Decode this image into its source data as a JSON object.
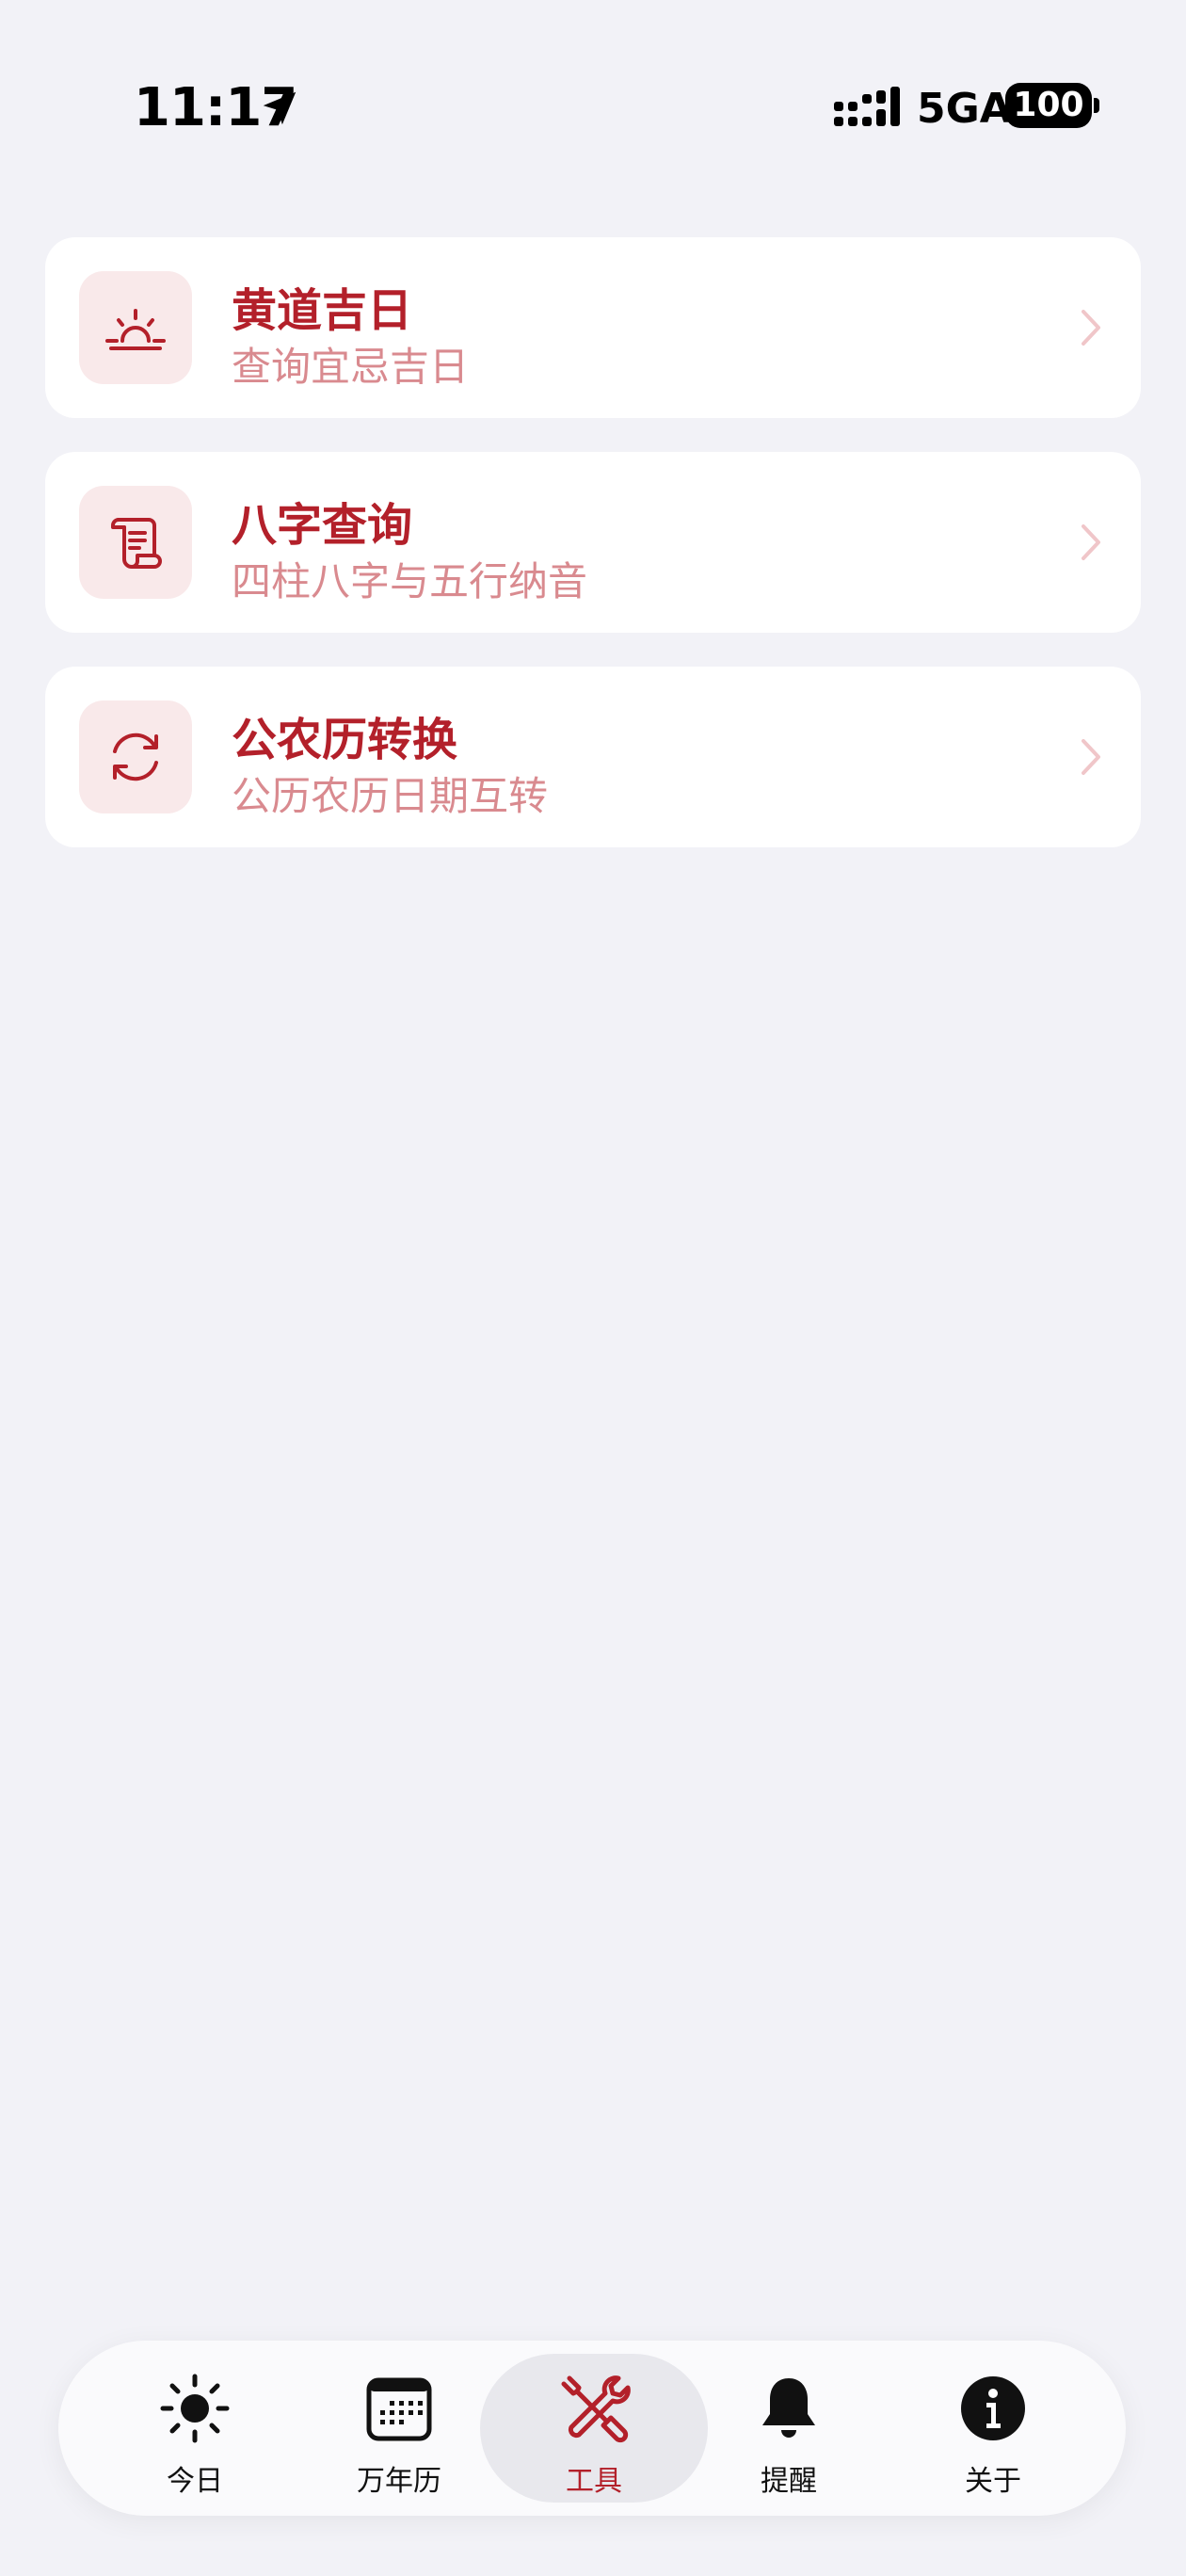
{
  "status_bar": {
    "time": "11:17",
    "network": "5GA",
    "battery": "100"
  },
  "tools": [
    {
      "title": "黄道吉日",
      "subtitle": "查询宜忌吉日",
      "icon": "sunrise-icon"
    },
    {
      "title": "八字查询",
      "subtitle": "四柱八字与五行纳音",
      "icon": "scroll-icon"
    },
    {
      "title": "公农历转换",
      "subtitle": "公历农历日期互转",
      "icon": "sync-arrows-icon"
    }
  ],
  "tab_bar": {
    "items": [
      {
        "label": "今日",
        "icon": "sun-icon"
      },
      {
        "label": "万年历",
        "icon": "calendar-icon"
      },
      {
        "label": "工具",
        "icon": "tools-icon"
      },
      {
        "label": "提醒",
        "icon": "bell-icon"
      },
      {
        "label": "关于",
        "icon": "info-icon"
      }
    ],
    "selected": "工具"
  },
  "colors": {
    "accent": "#b3202a",
    "subtitle": "#d98a8f",
    "icon_bg": "#f9e9ea",
    "background": "#f2f2f7"
  }
}
